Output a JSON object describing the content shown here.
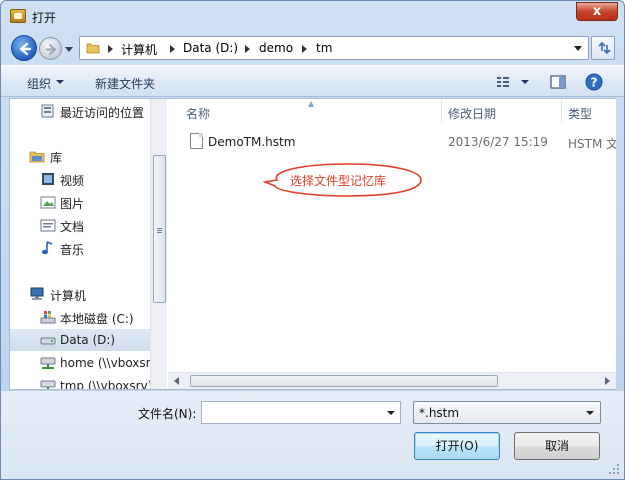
{
  "window": {
    "title": "打开",
    "close_label": "x"
  },
  "address": {
    "crumbs": [
      "计算机",
      "Data (D:)",
      "demo",
      "tm"
    ]
  },
  "toolbar": {
    "organize_label": "组织",
    "new_folder_label": "新建文件夹"
  },
  "nav": {
    "items": [
      {
        "label": "最近访问的位置",
        "icon": "recent-places-icon"
      },
      {
        "label": "库",
        "icon": "library-icon"
      },
      {
        "label": "视频",
        "icon": "video-icon"
      },
      {
        "label": "图片",
        "icon": "picture-icon"
      },
      {
        "label": "文档",
        "icon": "document-icon"
      },
      {
        "label": "音乐",
        "icon": "music-icon"
      },
      {
        "label": "计算机",
        "icon": "computer-icon"
      },
      {
        "label": "本地磁盘 (C:)",
        "icon": "local-disk-icon"
      },
      {
        "label": "Data (D:)",
        "icon": "drive-icon",
        "selected": true
      },
      {
        "label": "home (\\\\vboxsr",
        "icon": "network-drive-icon"
      },
      {
        "label": "tmp (\\\\vboxsrv)",
        "icon": "network-drive-icon"
      }
    ]
  },
  "files": {
    "columns": [
      "名称",
      "修改日期",
      "类型"
    ],
    "rows": [
      {
        "name": "DemoTM.hstm",
        "modified": "2013/6/27 15:19",
        "type": "HSTM 文"
      }
    ]
  },
  "annotation": {
    "text": "选择文件型记忆库",
    "color": "#e23d2a"
  },
  "bottom": {
    "filename_label": "文件名(N):",
    "filename_value": "",
    "filter_value": "*.hstm",
    "open_label": "打开(O)",
    "cancel_label": "取消"
  }
}
